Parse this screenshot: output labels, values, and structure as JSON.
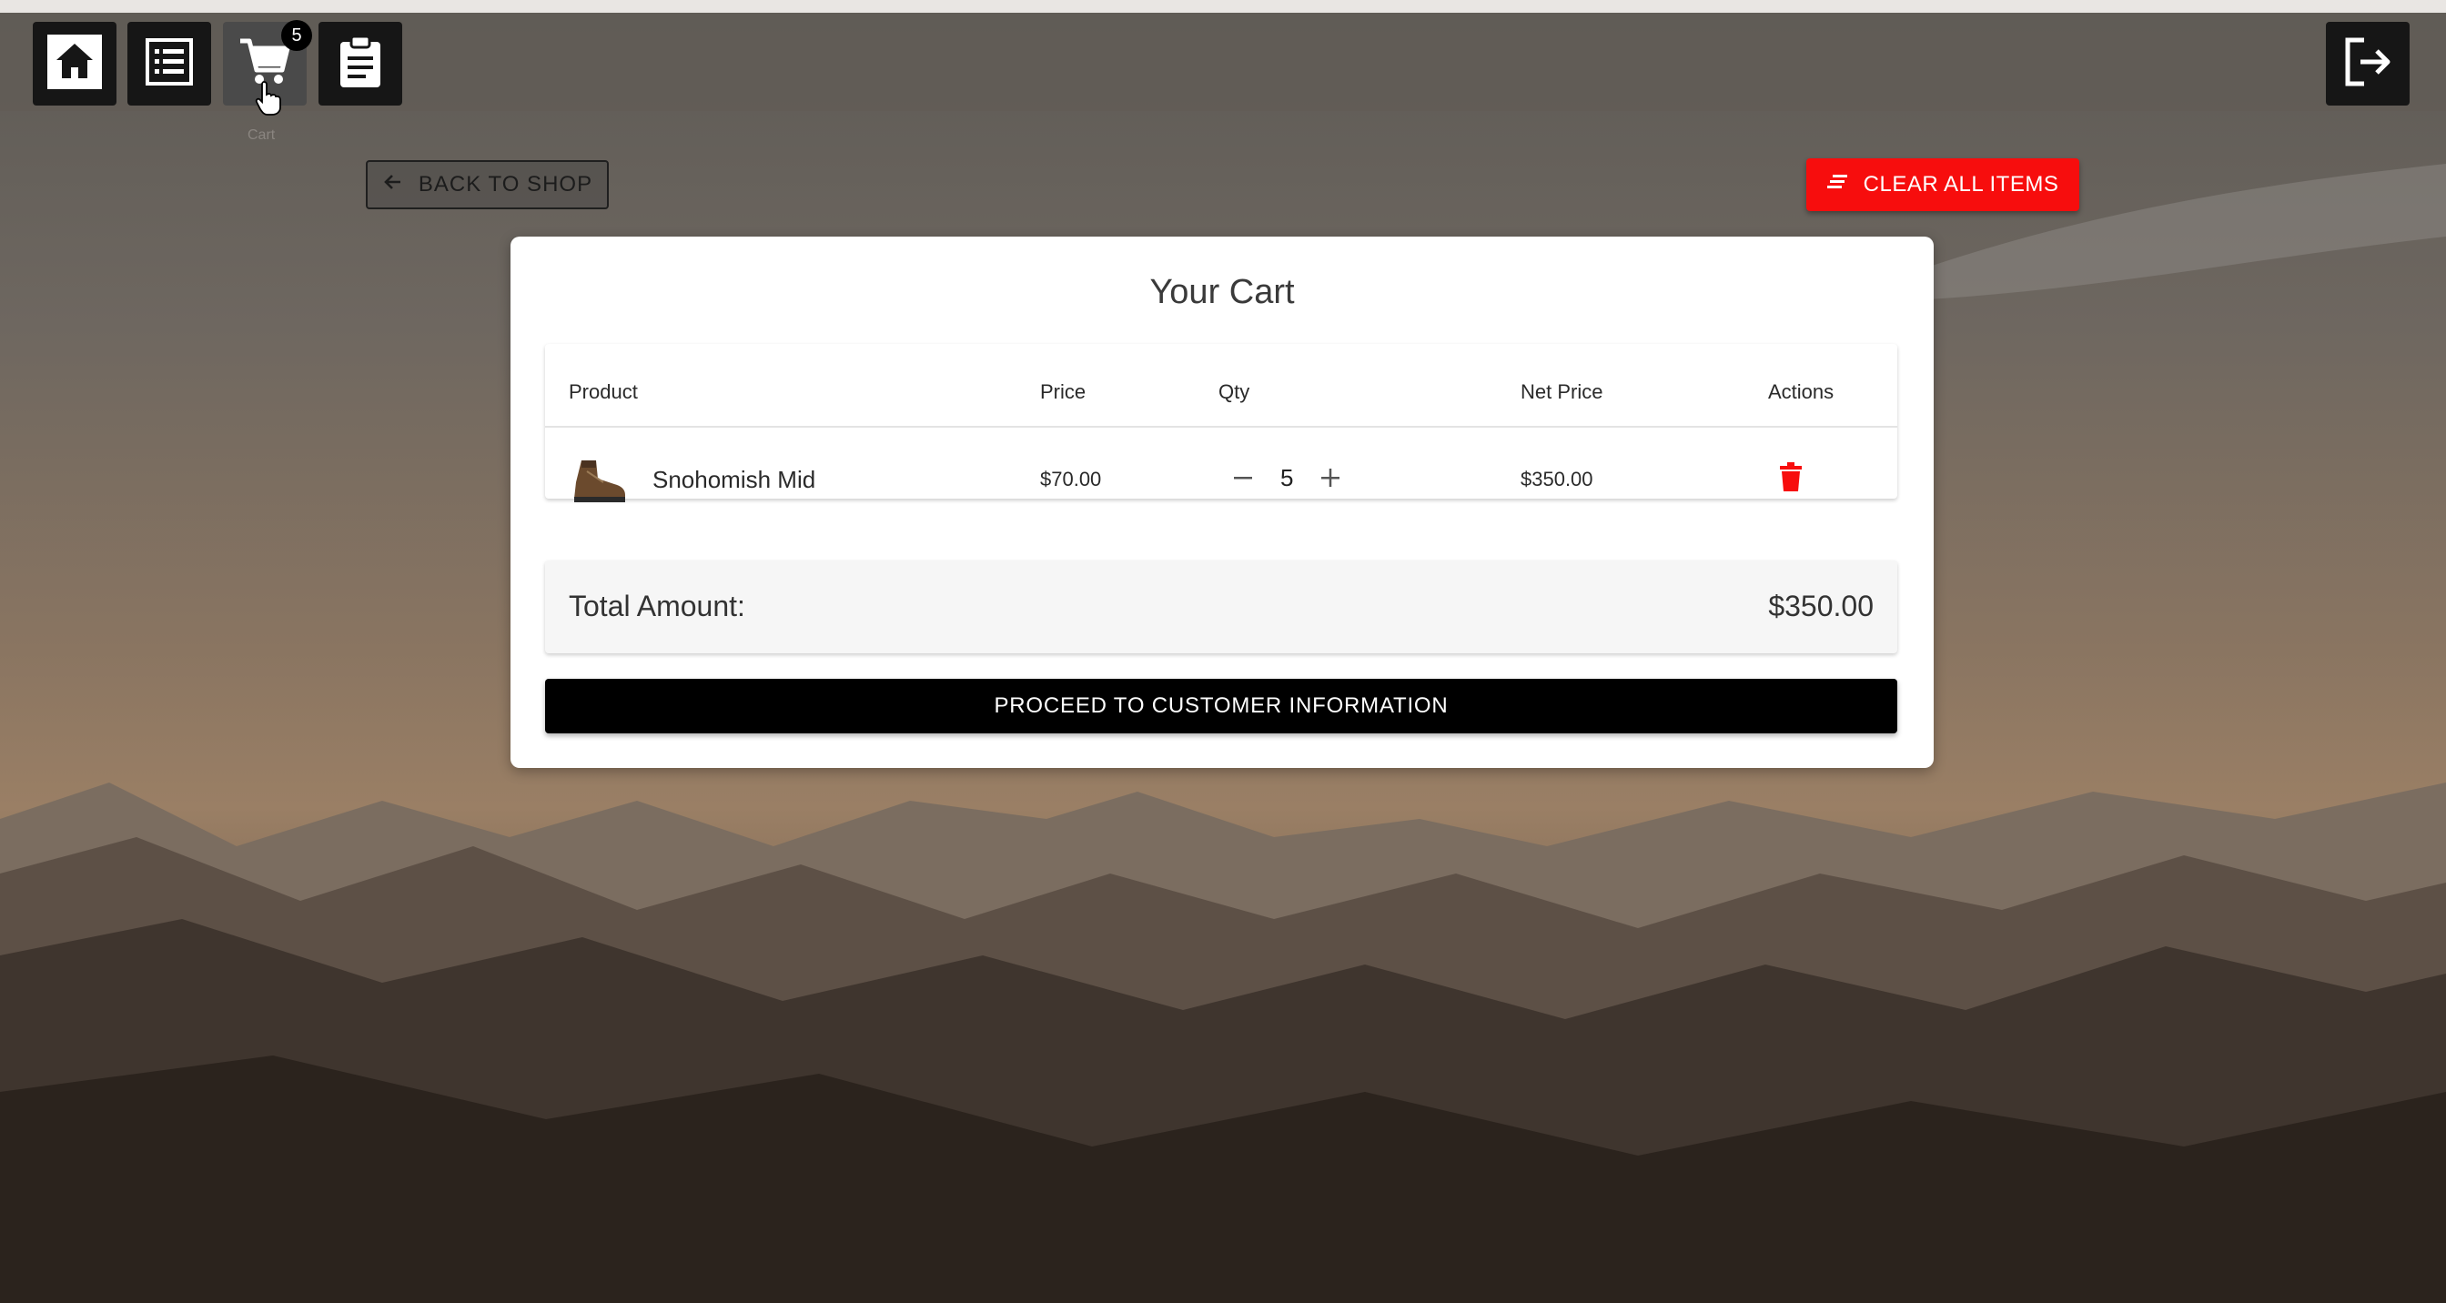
{
  "nav": {
    "home_icon": "home-icon",
    "list_icon": "list-icon",
    "cart_icon": "cart-icon",
    "cart_count": "5",
    "orders_icon": "clipboard-icon",
    "logout_icon": "logout-icon",
    "cart_tooltip": "Cart"
  },
  "actions": {
    "back_label": "BACK TO SHOP",
    "clear_label": "CLEAR ALL ITEMS"
  },
  "cart": {
    "title": "Your Cart",
    "columns": [
      "Product",
      "Price",
      "Qty",
      "Net Price",
      "Actions"
    ],
    "items": [
      {
        "name": "Snohomish Mid",
        "price": "$70.00",
        "qty": "5",
        "net_price": "$350.00"
      }
    ],
    "total_label": "Total Amount:",
    "total_value": "$350.00",
    "proceed_label": "PROCEED TO CUSTOMER INFORMATION"
  },
  "colors": {
    "accent_red": "#f70d0d",
    "primary_black": "#000000"
  }
}
